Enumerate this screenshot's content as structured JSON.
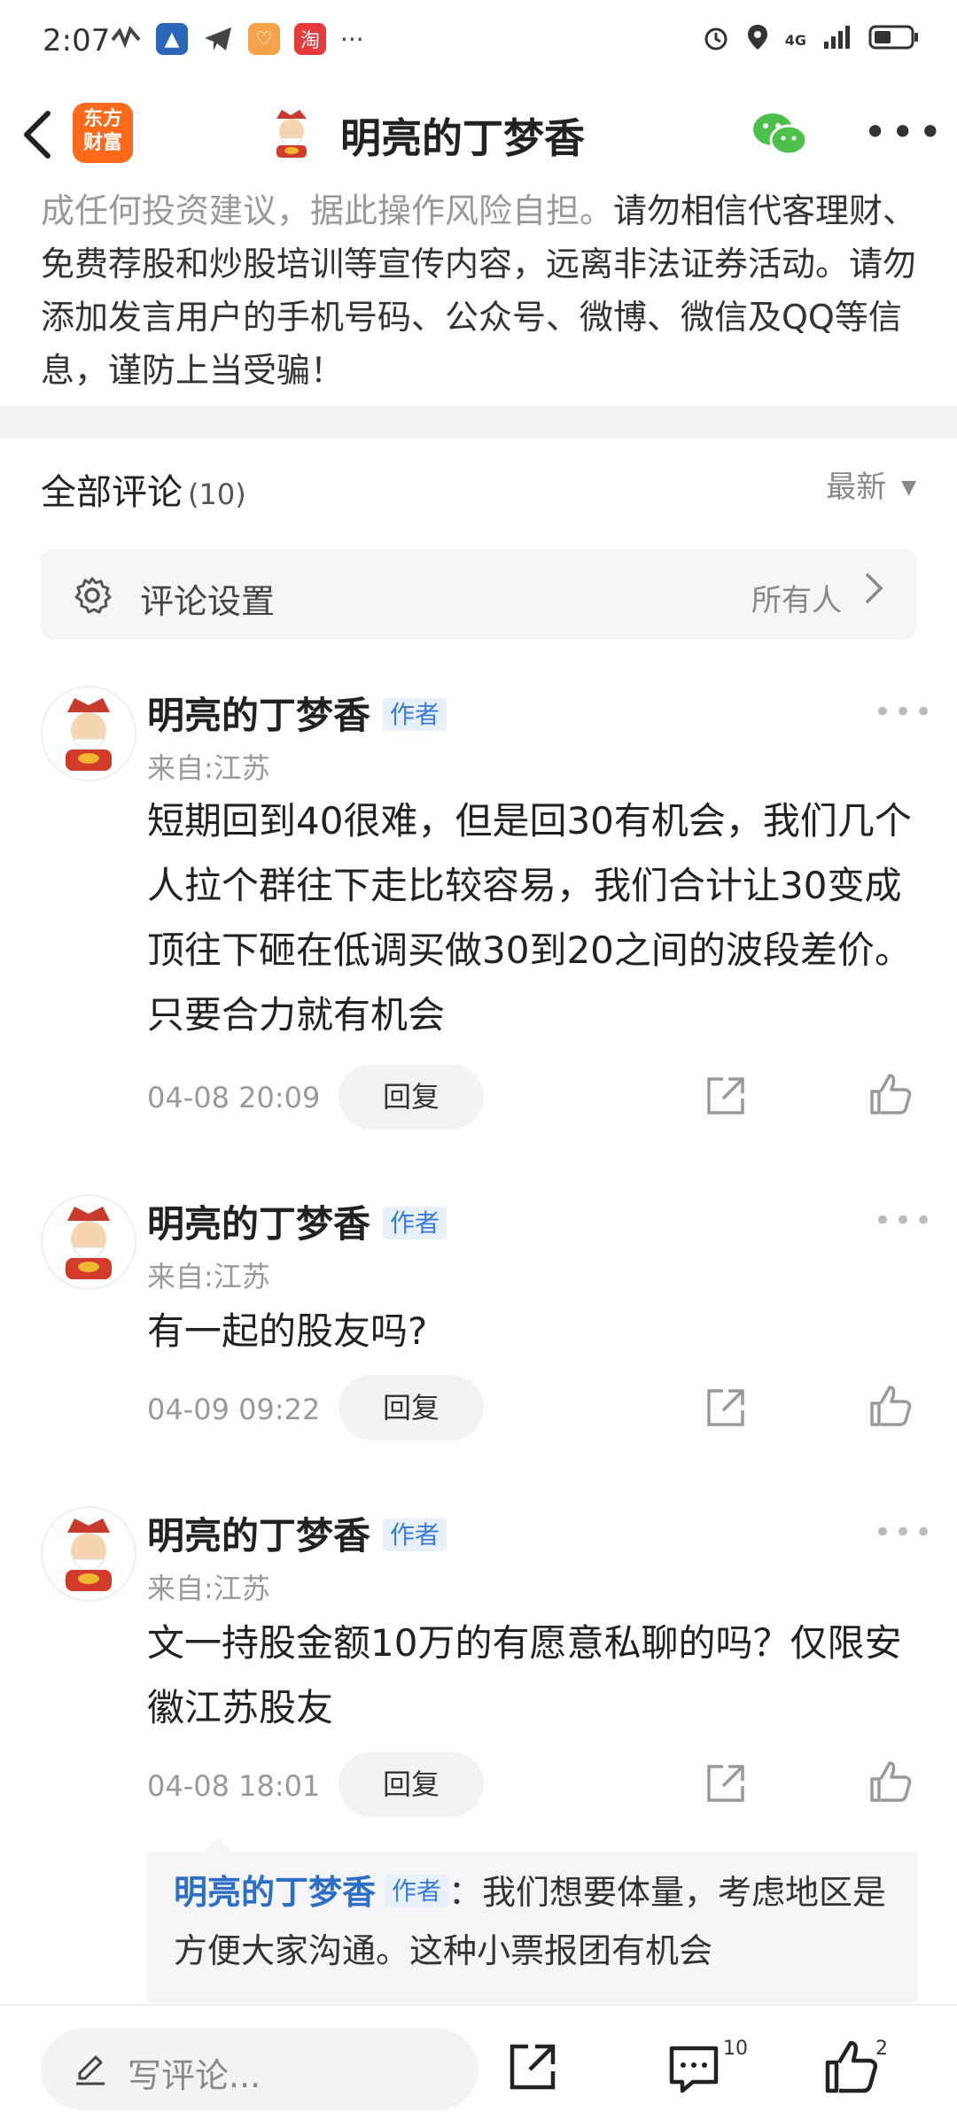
{
  "status_bar": {
    "time": "2:07",
    "more": "···",
    "network": "4G"
  },
  "header": {
    "back": "<",
    "logo_line1": "东方",
    "logo_line2": "财富",
    "title": "明亮的丁梦香",
    "more": "•••"
  },
  "disclaimer": {
    "gray_text": "成任何投资建议，据此操作风险自担。",
    "dark_text": "请勿相信代客理财、免费荐股和炒股培训等宣传内容，远离非法证券活动。请勿添加发言用户的手机号码、公众号、微博、微信及QQ等信息，谨防上当受骗！"
  },
  "comments_section": {
    "title": "全部评论",
    "count": "(10)",
    "sort_label": "最新",
    "settings_label": "评论设置",
    "settings_value": "所有人"
  },
  "comments": [
    {
      "name": "明亮的丁梦香",
      "tag": "作者",
      "location": "来自:江苏",
      "body": "短期回到40很难，但是回30有机会，我们几个人拉个群往下走比较容易，我们合计让30变成顶往下砸在低调买做30到20之间的波段差价。只要合力就有机会",
      "time": "04-08 20:09",
      "reply": "回复"
    },
    {
      "name": "明亮的丁梦香",
      "tag": "作者",
      "location": "来自:江苏",
      "body": "有一起的股友吗?",
      "time": "04-09 09:22",
      "reply": "回复"
    },
    {
      "name": "明亮的丁梦香",
      "tag": "作者",
      "location": "来自:江苏",
      "body": "文一持股金额10万的有愿意私聊的吗？仅限安徽江苏股友",
      "time": "04-08 18:01",
      "reply": "回复"
    }
  ],
  "nested_reply": {
    "name": "明亮的丁梦香",
    "tag": "作者",
    "text": "：我们想要体量，考虑地区是方便大家沟通。这种小票报团有机会"
  },
  "bottom_bar": {
    "placeholder": "写评论...",
    "comment_count": "10",
    "like_count": "2"
  },
  "colors": {
    "brand_orange": "#ff6a1a",
    "link_blue": "#2d6fc6",
    "wechat_green": "#4cc04a"
  }
}
